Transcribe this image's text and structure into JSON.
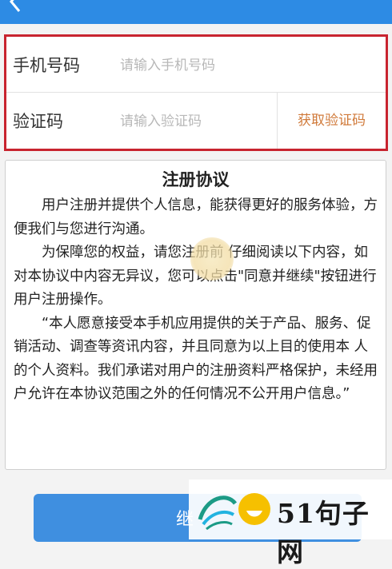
{
  "header": {
    "title": "",
    "back_icon": "chevron-left-icon"
  },
  "form": {
    "phone": {
      "label": "手机号码",
      "placeholder": "请输入手机号码"
    },
    "code": {
      "label": "验证码",
      "placeholder": "请输入验证码",
      "button": "获取验证码"
    }
  },
  "agreement": {
    "title": "注册协议",
    "paragraphs": [
      "用户注册并提供个人信息，能获得更好的服务体验，方便我们与您进行沟通。",
      "为保障您的权益，请您注册前 仔细阅读以下内容，如对本协议中内容无异议，您可以点击\"同意并继续\"按钮进行用户注册操作。",
      "“本人愿意接受本手机应用提供的关于产品、服务、促销活动、调查等资讯内容，并且同意为以上目的使用本 人的个人资料。我们承诺对用户的注册资料严格保护，未经用户允许在本协议范围之外的任何情况不公开用户信息。”"
    ]
  },
  "continue_button": {
    "label": "继"
  },
  "watermark": {
    "text": "51句子网",
    "logo_icon": "watermark-logo-icon"
  },
  "colors": {
    "header": "#2d8be4",
    "form_border": "#c8242f",
    "code_button": "#d07a3a",
    "continue_button": "#3f8fe0"
  }
}
